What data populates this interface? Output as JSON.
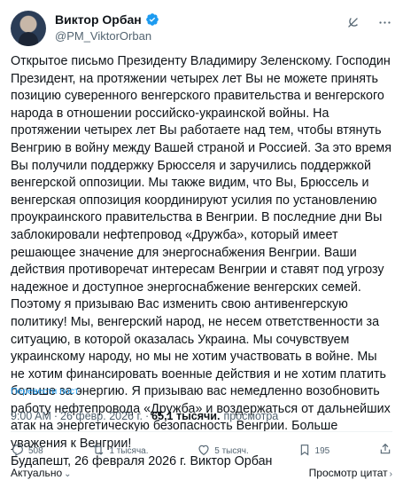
{
  "header": {
    "name": "Виктор Орбан",
    "handle": "@PM_ViktorOrban"
  },
  "tweet": {
    "text": "Открытое письмо Президенту Владимиру Зеленскому. Господин Президент, на протяжении четырех лет Вы не можете принять позицию суверенного венгерского правительства и венгерского народа в отношении российско-украинской войны. На протяжении четырех лет Вы работаете над тем, чтобы втянуть Венгрию в войну между Вашей страной и Россией. За это время Вы получили поддержку Брюсселя и заручились поддержкой венгерской оппозиции. Мы также видим, что Вы, Брюссель и венгерская оппозиция координируют усилия по установлению проукраинского правительства в Венгрии. В последние дни Вы заблокировали нефтепровод «Дружба», который имеет решающее значение для энергоснабжения Венгрии. Ваши действия противоречат интересам Венгрии и ставят под угрозу надежное и доступное энергоснабжение венгерских семей. Поэтому я призываю Вас изменить свою антивенгерскую политику! Мы, венгерский народ, не несем ответственности за ситуацию, в которой оказалась Украина. Мы сочувствуем украинскому народу, но мы не хотим участвовать в войне. Мы не хотим финансировать военные действия и не хотим платить больше за энергию. Я призываю вас немедленно возобновить работу нефтепровода «Дружба» и воздержаться от дальнейших атак на энергетическую безопасность Венгрии. Больше уважения к Венгрии!\nБудапешт, 26 февраля 2026 г. Виктор Орбан",
    "translate_label": "Перевести пост"
  },
  "meta": {
    "time": "9:00 AM",
    "date": "26 февр. 2026 г.",
    "views_count": "65,1 тысячи.",
    "views_label": "просмотра",
    "separator": "·"
  },
  "actions": {
    "replies": "508",
    "reposts": "1 тысяча.",
    "likes": "5 тысяч.",
    "bookmarks": "195"
  },
  "footer": {
    "sort_label": "Актуально",
    "quotes_label": "Просмотр цитат"
  },
  "colors": {
    "accent": "#1d9bf0",
    "verified": "#1d9bf0",
    "muted": "#536471"
  }
}
